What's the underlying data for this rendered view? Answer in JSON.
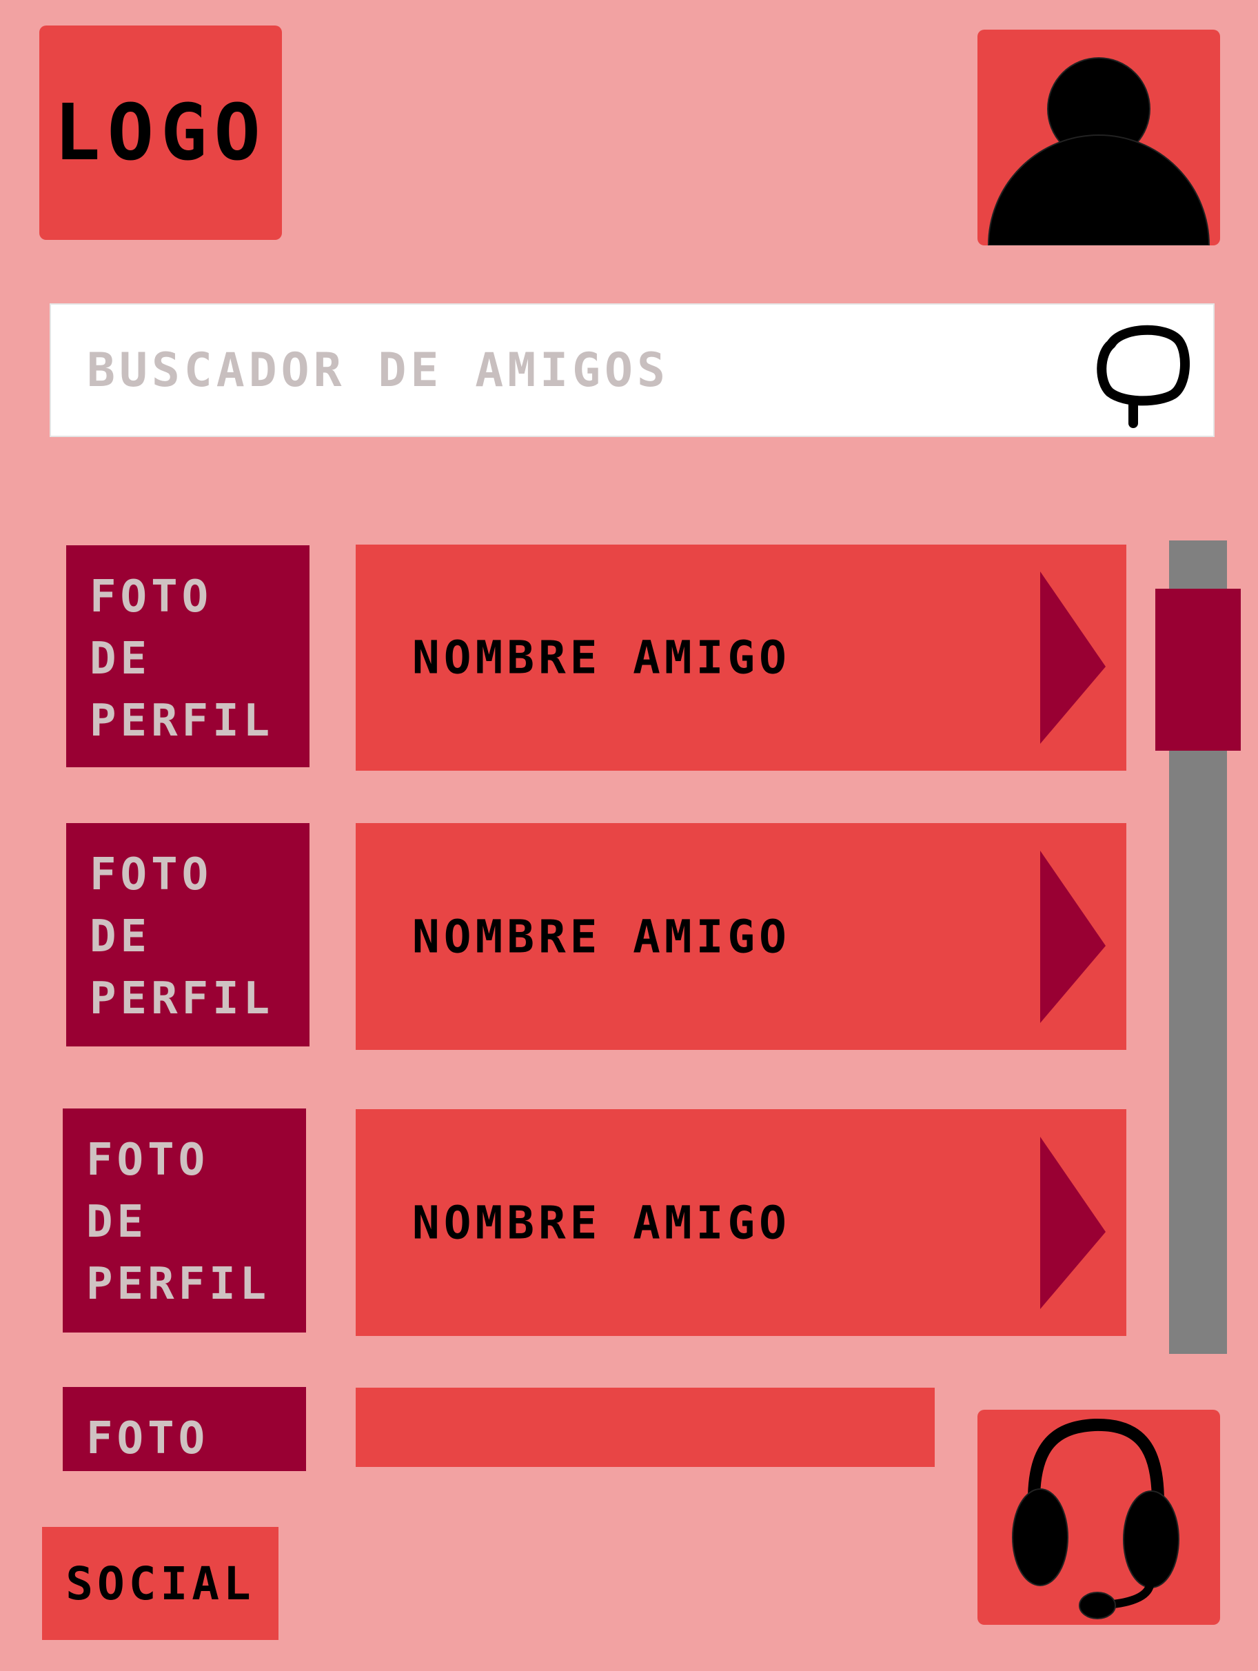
{
  "header": {
    "logo_label": "LOGO",
    "avatar_icon": "user-silhouette-icon"
  },
  "search": {
    "placeholder": "BUSCADOR DE AMIGOS",
    "icon": "search-icon"
  },
  "friends": [
    {
      "photo_lines": [
        "FOTO",
        "DE",
        "PERFIL"
      ],
      "name": "NOMBRE AMIGO"
    },
    {
      "photo_lines": [
        "FOTO",
        "DE",
        "PERFIL"
      ],
      "name": "NOMBRE AMIGO"
    },
    {
      "photo_lines": [
        "FOTO",
        "DE",
        "PERFIL"
      ],
      "name": "NOMBRE AMIGO"
    },
    {
      "photo_lines": [
        "FOTO"
      ],
      "name": ""
    }
  ],
  "footer": {
    "social_label": "SOCIAL",
    "support_icon": "headset-icon"
  },
  "colors": {
    "background": "#f2a2a2",
    "accent": "#e84545",
    "dark_accent": "#990033",
    "scrollbar_track": "#808080"
  }
}
